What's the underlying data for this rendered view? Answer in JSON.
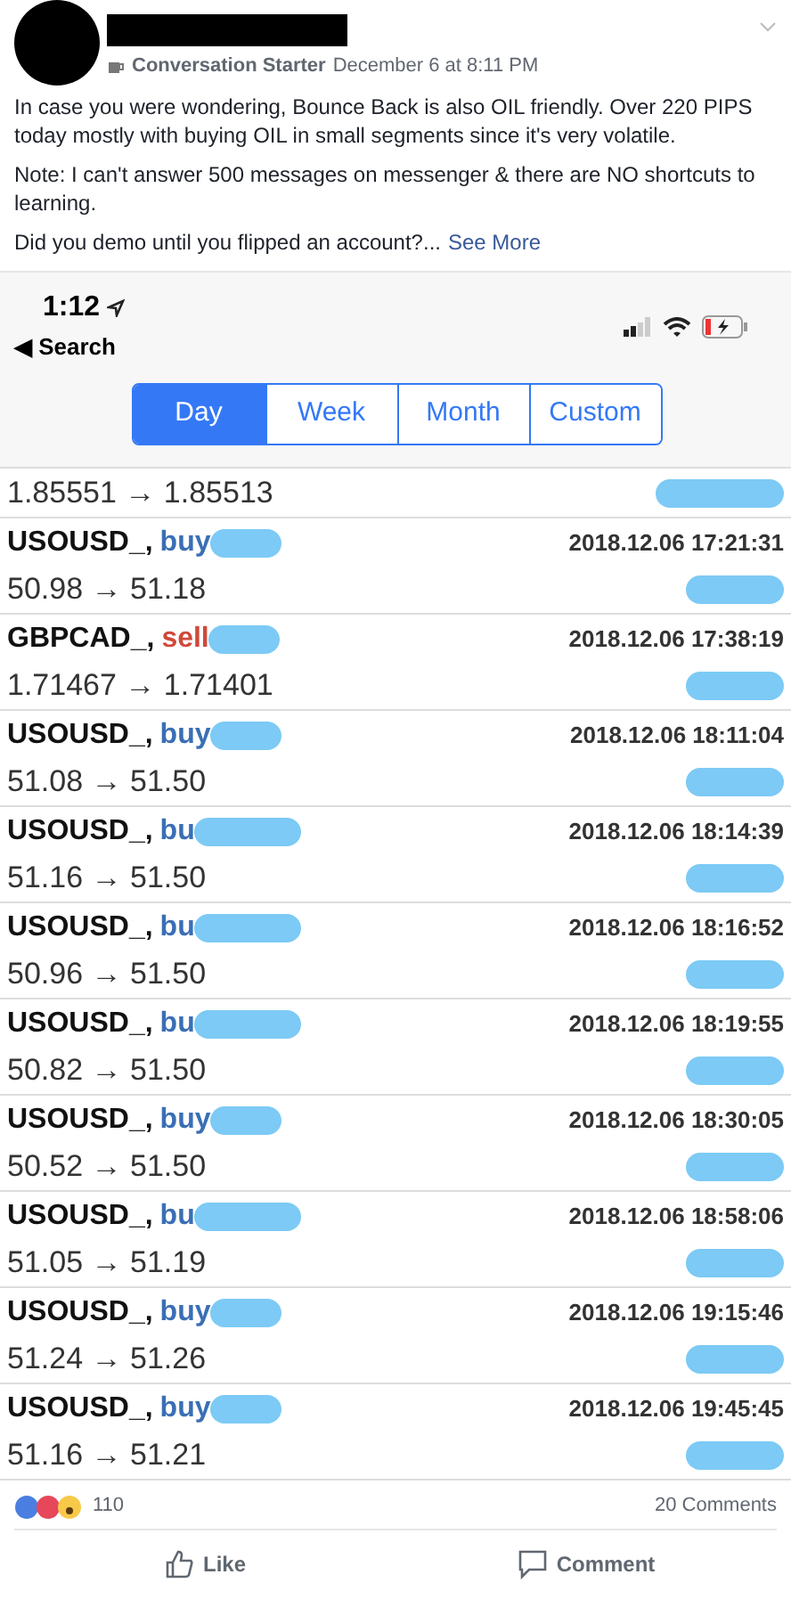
{
  "post": {
    "group": "Conversation Starter",
    "date": "December 6 at 8:11 PM",
    "paragraphs": [
      "In case you were wondering, Bounce Back is also OIL friendly. Over 220 PIPS today mostly with buying OIL in small segments since it's very volatile.",
      "Note: I can't answer 500 messages on messenger & there are NO shortcuts to learning."
    ],
    "last_line": "Did you demo until you flipped an account?...",
    "see_more": "See More"
  },
  "phone": {
    "time": "1:12",
    "back": "◀ Search",
    "tabs": [
      {
        "label": "Day",
        "selected": true
      },
      {
        "label": "Week",
        "selected": false
      },
      {
        "label": "Month",
        "selected": false
      },
      {
        "label": "Custom",
        "selected": false
      }
    ],
    "first_prices": "1.85551 → 1.85513",
    "trades": [
      {
        "symbol": "USOUSD_,",
        "side": "buy",
        "kind": "buy",
        "time": "2018.12.06 17:21:31",
        "prices": "50.98 → 51.18"
      },
      {
        "symbol": "GBPCAD_,",
        "side": "sell",
        "kind": "sell",
        "time": "2018.12.06 17:38:19",
        "prices": "1.71467 → 1.71401"
      },
      {
        "symbol": "USOUSD_,",
        "side": "buy",
        "kind": "buy",
        "time": "2018.12.06 18:11:04",
        "prices": "51.08 → 51.50"
      },
      {
        "symbol": "USOUSD_,",
        "side": "bu",
        "kind": "buy",
        "time": "2018.12.06 18:14:39",
        "prices": "51.16 → 51.50"
      },
      {
        "symbol": "USOUSD_,",
        "side": "bu",
        "kind": "buy",
        "time": "2018.12.06 18:16:52",
        "prices": "50.96 → 51.50"
      },
      {
        "symbol": "USOUSD_,",
        "side": "bu",
        "kind": "buy",
        "time": "2018.12.06 18:19:55",
        "prices": "50.82 → 51.50"
      },
      {
        "symbol": "USOUSD_,",
        "side": "buy",
        "kind": "buy",
        "time": "2018.12.06 18:30:05",
        "prices": "50.52 → 51.50"
      },
      {
        "symbol": "USOUSD_,",
        "side": "bu",
        "kind": "buy",
        "time": "2018.12.06 18:58:06",
        "prices": "51.05 → 51.19"
      },
      {
        "symbol": "USOUSD_,",
        "side": "buy",
        "kind": "buy",
        "time": "2018.12.06 19:15:46",
        "prices": "51.24 → 51.26"
      },
      {
        "symbol": "USOUSD_,",
        "side": "buy",
        "kind": "buy",
        "time": "2018.12.06 19:45:45",
        "prices": "51.16 → 51.21"
      }
    ]
  },
  "footer": {
    "reactions": "110",
    "comments": "20 Comments",
    "actions": [
      "Like",
      "Comment"
    ]
  }
}
